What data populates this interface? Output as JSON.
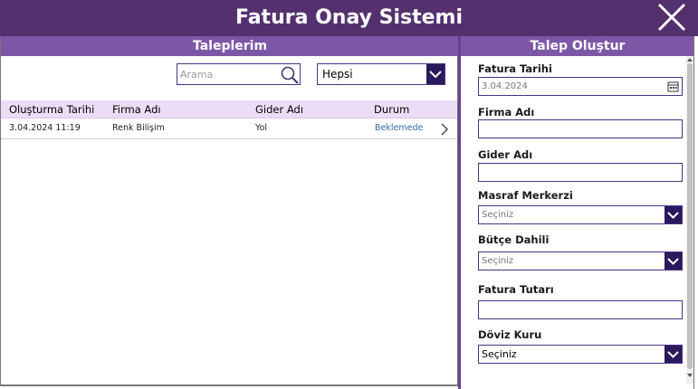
{
  "header": {
    "title": "Fatura Onay Sistemi"
  },
  "left": {
    "title": "Taleplerim",
    "search": {
      "placeholder": "Arama",
      "value": ""
    },
    "filter": {
      "selected": "Hepsi"
    },
    "columns": [
      "Oluşturma Tarihi",
      "Firma Adı",
      "Gider Adı",
      "Durum"
    ],
    "rows": [
      {
        "created": "3.04.2024 11:19",
        "company": "Renk Bilişim",
        "expense": "Yol",
        "status": "Beklemede"
      }
    ]
  },
  "right": {
    "title": "Talep Oluştur",
    "fields": {
      "invoice_date": {
        "label": "Fatura Tarihi",
        "value": "3.04.2024"
      },
      "company": {
        "label": "Firma Adı",
        "value": ""
      },
      "expense": {
        "label": "Gider Adı",
        "value": ""
      },
      "cost_center": {
        "label": "Masraf Merkerzi",
        "value": "Seçiniz"
      },
      "budget": {
        "label": "Bütçe Dahili",
        "value": "Seçiniz"
      },
      "amount": {
        "label": "Fatura Tutarı",
        "value": ""
      },
      "currency": {
        "label": "Döviz Kuru",
        "value": "Seçiniz"
      }
    }
  },
  "colors": {
    "header": "#54306f",
    "panel_header": "#7d57a5",
    "table_head": "#ecdcf5",
    "dropdown": "#2a1a5c",
    "border": "#4f2f86",
    "status": "#2e6da4"
  }
}
